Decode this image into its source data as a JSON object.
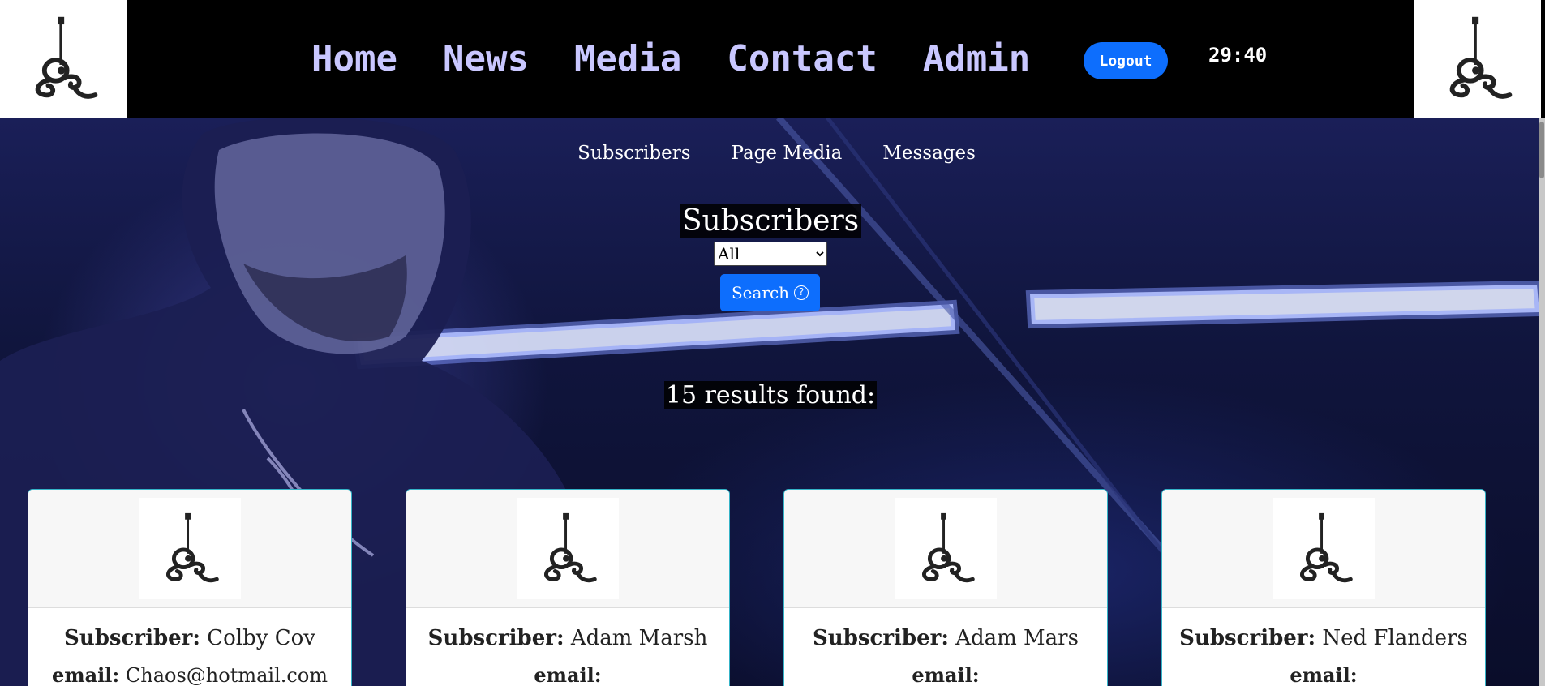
{
  "header": {
    "nav": [
      "Home",
      "News",
      "Media",
      "Contact",
      "Admin"
    ],
    "logout_label": "Logout",
    "timer": "29:40"
  },
  "subnav": [
    "Subscribers",
    "Page Media",
    "Messages"
  ],
  "page": {
    "title": "Subscribers",
    "filter": {
      "selected": "All",
      "options": [
        "All"
      ]
    },
    "search_label": "Search",
    "results_text": "15 results found:"
  },
  "cards": [
    {
      "subscriber_label": "Subscriber:",
      "name": "Colby Cov",
      "email_label": "email:",
      "email": "Chaos@hotmail.com"
    },
    {
      "subscriber_label": "Subscriber:",
      "name": "Adam Marsh",
      "email_label": "email:",
      "email": ""
    },
    {
      "subscriber_label": "Subscriber:",
      "name": "Adam Mars",
      "email_label": "email:",
      "email": ""
    },
    {
      "subscriber_label": "Subscriber:",
      "name": "Ned Flanders",
      "email_label": "email:",
      "email": ""
    }
  ],
  "colors": {
    "header_bg": "#000000",
    "nav_text": "#c9c7ff",
    "button_blue": "#0d6efd",
    "card_border": "#34b3c7"
  },
  "icons": {
    "logo": "guitar-sr-logo-icon",
    "help": "question-circle-icon",
    "select": "chevron-down-icon"
  }
}
